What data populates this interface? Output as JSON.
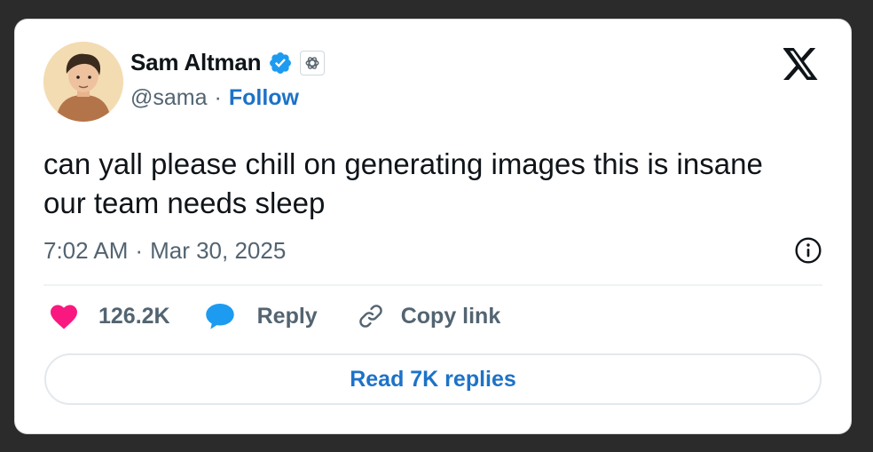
{
  "author": {
    "display_name": "Sam Altman",
    "handle": "@sama",
    "follow_label": "Follow",
    "separator": "·"
  },
  "tweet": {
    "text": "can yall please chill on generating images this is insane our team needs sleep",
    "time": "7:02 AM",
    "date": "Mar 30, 2025"
  },
  "actions": {
    "like_count": "126.2K",
    "reply_label": "Reply",
    "copy_link_label": "Copy link",
    "read_replies_label": "Read 7K replies"
  },
  "icons": {
    "verified": "verified-badge-icon",
    "affiliate": "openai-logo-icon",
    "platform": "x-logo-icon",
    "info": "info-icon",
    "like": "heart-icon",
    "reply": "speech-bubble-icon",
    "copy": "link-icon"
  },
  "colors": {
    "link_blue": "#1d72c8",
    "verified_blue": "#1d9bf0",
    "heart_pink": "#f91880",
    "text_primary": "#0f1419",
    "text_secondary": "#536471"
  }
}
